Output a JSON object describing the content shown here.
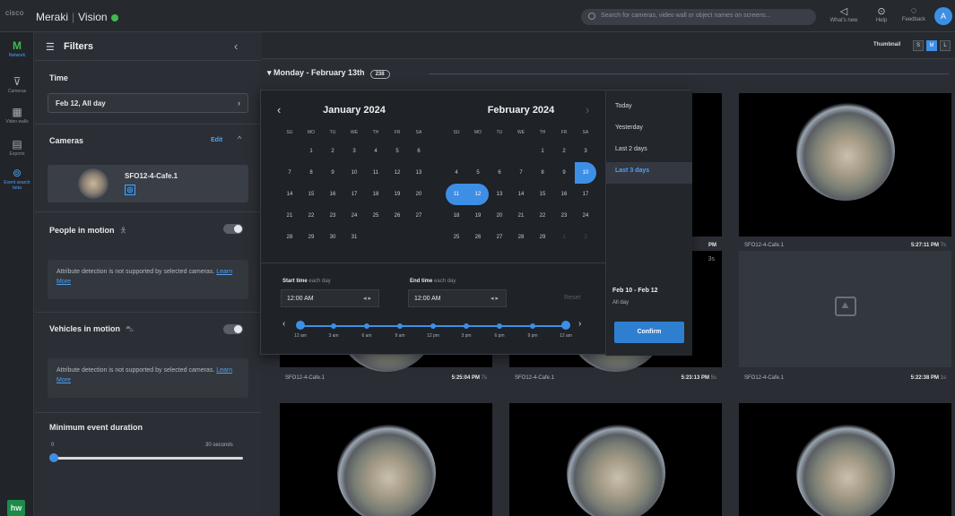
{
  "topbar": {
    "cisco": "cisco",
    "brand": "Meraki",
    "product": "Vision",
    "search_placeholder": "Search for cameras, video wall or object names on screens...",
    "whats_new": "What's new",
    "help": "Help",
    "feedback": "Feedback",
    "avatar": "A"
  },
  "rail": {
    "logo": "M",
    "network": "Network",
    "items": [
      {
        "label": "Cameras",
        "icon": "camera-icon"
      },
      {
        "label": "Video walls",
        "icon": "grid-icon"
      },
      {
        "label": "Exports",
        "icon": "export-icon"
      },
      {
        "label": "Event search beta",
        "icon": "search-icon"
      }
    ],
    "bottom": "hw"
  },
  "filters": {
    "title": "Filters",
    "time": {
      "label": "Time",
      "value": "Feb 12, All day"
    },
    "cameras": {
      "label": "Cameras",
      "edit": "Edit",
      "camera_name": "SFO12-4-Cafe.1"
    },
    "people": {
      "label": "People in motion",
      "note": "Attribute detection is not supported by selected cameras.",
      "link": "Learn More"
    },
    "vehicles": {
      "label": "Vehicles in motion",
      "note": "Attribute detection is not supported by selected cameras.",
      "link": "Learn More"
    },
    "duration": {
      "label": "Minimum event duration",
      "min": "0",
      "max": "30 seconds",
      "value": 0
    }
  },
  "viewbar": {
    "label": "Thumbnail",
    "sizes": [
      "S",
      "M",
      "L"
    ],
    "active": "M"
  },
  "day": {
    "label": "Monday - February 13th",
    "count": "238"
  },
  "tiles": [
    {
      "name": "SFO12-4-Cafe.1",
      "time": "5:27:11 PM",
      "tag": "7s"
    },
    {
      "name": "SFO12-4-Cafe.1",
      "time": "5:25:04 PM",
      "tag": "7s"
    },
    {
      "name": "SFO12-4-Cafe.1",
      "time": "5:23:13 PM",
      "tag": "5s"
    },
    {
      "name": "SFO12-4-Cafe.1",
      "time": "5:22:38 PM",
      "tag": "1s"
    },
    {
      "name": "",
      "time": "PM",
      "tag": "3s"
    }
  ],
  "picker": {
    "january": {
      "title": "January 2024"
    },
    "february": {
      "title": "February 2024"
    },
    "weekdays": [
      "SU",
      "MO",
      "TU",
      "WE",
      "TH",
      "FR",
      "SA"
    ],
    "quick": [
      "Today",
      "Yesterday",
      "Last 2 days",
      "Last 3 days"
    ],
    "quick_active": "Last 3 days",
    "start_label": "Start time",
    "end_label": "End time",
    "each_day": "each day",
    "start_value": "12:00 AM",
    "end_value": "12:00 AM",
    "reset": "Reset",
    "hours": [
      "12 am",
      "3 am",
      "6 am",
      "9 am",
      "12 pm",
      "3 pm",
      "6 pm",
      "9 pm",
      "12 am"
    ],
    "summary_range": "Feb 10 - Feb 12",
    "summary_sub": "All day",
    "confirm": "Confirm"
  }
}
